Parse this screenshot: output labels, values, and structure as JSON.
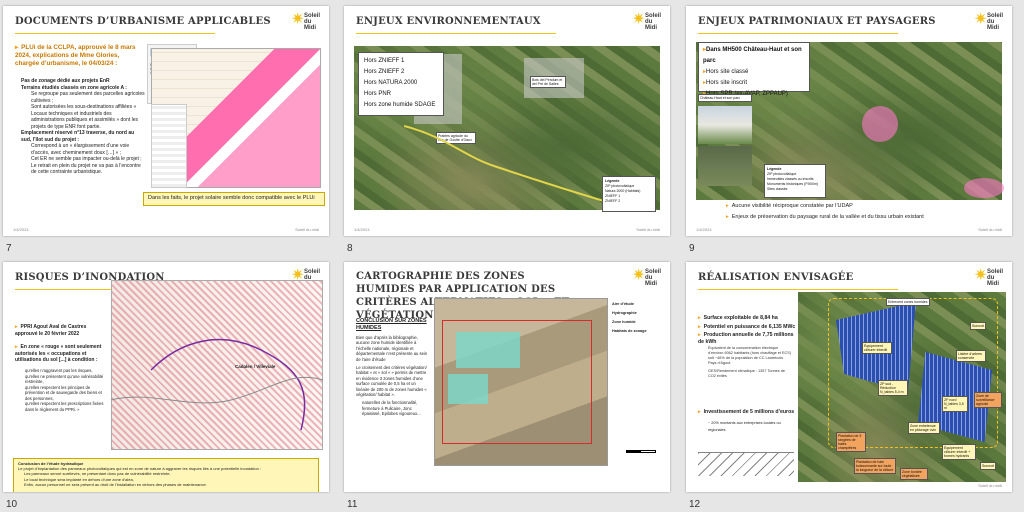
{
  "slides": [
    {
      "number": "7",
      "title": "DOCUMENTS D’URBANISME APPLICABLES",
      "intro": "PLUi de la CCLPA, approuvé le 8 mars 2024, explications de Mme Glories, chargée d’urbanisme, le 04/03/24 :",
      "bullets": [
        "Pas de zonage dédié aux projets EnR",
        "Terrains étudiés classés en zone agricole A :",
        "Se regroupe pas seulement des parcelles agricoles cultivées ;",
        "Sont autorisées les sous-destinations affiliées « Locaux techniques et industriels des administrations publiques et assimilés » dont les projets de type ENR font partie.",
        "Emplacement réservé n°13 traverse, du nord au sud, l’îlot sud du projet :",
        "Correspond à un « élargissement d’une voie d’accès, avec cheminement doux […] » ;",
        "Cet ER ne semble pas impacter ou-delà le projet ;",
        "Le retrait en plein du projet ne va pas à l’encontre de cette contrainte urbanistique."
      ],
      "plui_doc": "ÉLABORATION DU PLAN LOCAL D’URBANISME INTERCOMMUNAL",
      "conclusion": "Dans les faits, le projet solaire semble donc compatible avec le PLUi"
    },
    {
      "number": "8",
      "title": "ENJEUX ENVIRONNEMENTAUX",
      "items": [
        "Hors ZNIEFF 1",
        "Hors ZNIEFF 2",
        "Hors NATURA 2000",
        "Hors PNR",
        "Hors zone humide SDAGE"
      ],
      "labels": [
        "Bois del Pendum et del Pré de Salles",
        "Prairies agricole du bas de Goutte d'Oaux"
      ],
      "legend_title": "Légende",
      "legend": [
        "ZIP photovoltaïque",
        "Natura 2000 (Habitats)",
        "ZNIEFF 1",
        "ZNIEFF 2"
      ]
    },
    {
      "number": "9",
      "title": "ENJEUX PATRIMONIAUX ET PAYSAGERS",
      "items": [
        "Dans MH500 Château-Haut et son parc",
        "Hors site classé",
        "Hors site inscrit",
        "Hors SPR (ex-AVAP, ZPPAUP)"
      ],
      "caption": "Château-Haut et son parc",
      "legend_title": "Légende",
      "legend": [
        "ZIP photovoltaïque",
        "Immeubles classés ou inscrits",
        "Monuments historiques (P.500m)",
        "Sites classés"
      ],
      "notes": [
        "Aucune visibilité réciproque constatée par l’UDAP",
        "Enjeux de préservation du paysage rural de la vallée et du tissu urbain existant"
      ]
    },
    {
      "number": "10",
      "title": "RISQUES D’INONDATION",
      "intro": "PPRI Agout Aval de Castres approuvé le 20 février 2022",
      "zone": "En zone « rouge » sont seulement autorisés les « occupations et utilisations du sol [...] à condition :",
      "subs": [
        "qu’elles n’aggravent pas les risques,",
        "qu’elles ne présentent qu’une vulnérabilité restreinte,",
        "qu’elles respectent les principes de prévention et de sauvegarde des biens et des personnes,",
        "qu’elles respectent les prescriptions fixées dans le règlement du PPRi. »"
      ],
      "map_label": "Cadalen / Villeviale",
      "conclusion_title": "Conclusion de l’étude hydraulique",
      "conclusion": [
        "Le projet d’implantation des panneaux photovoltaïques qui est en zone de nature à aggraver les risques liés à une potentielle inondation :",
        "Les panneaux seront surélevés, ne présentant donc pas de vulnérabilité restreinte,",
        "Le local technique sera implanté en dehors d’une zone d’aléa,",
        "Enfin, aucun personnel ne sera présent au droit de l’installation en dehors des phases de maintenance."
      ]
    },
    {
      "number": "11",
      "title": "CARTOGRAPHIE DES ZONES HUMIDES PAR APPLICATION DES CRITÈRES ALTERNATIFS « SOL » ET « VÉGÉTATION »",
      "conclusion_head": "CONCLUSION SUR ZONES HUMIDES",
      "text": [
        "Bien que d’après la bibliographie, aucune zone humide identifiée à l’échelle nationale, régionale et départementale n’est présente au sein de l’aire d’étude",
        "Le croisement des critères végétation/ habitat « et » sol « » permis de mettre en évidence 3 zones humides d’une surface cumulée de 0,5 ha et un linéaire de 200 m de zones humides « végétation/ habitat »."
      ],
      "subs": [
        "naturelles de la fonctionnalité,",
        "fermeture à Pulicaire, Jonc épaisissé, Epilobes vigoureux..."
      ],
      "legend": [
        "Aire d’étude",
        "Hydrographie",
        "Zone humide",
        "Habitats de zonage"
      ]
    },
    {
      "number": "12",
      "title": "RÉALISATION ENVISAGÉE",
      "items": [
        "Surface exploitable de 8,84 ha",
        "Potentiel en puissance de 6,135 MWc",
        "Production annuelle de 7,75 millions de kWh",
        "Investissement de 5 millions d’euros"
      ],
      "subs": [
        "Équivalent de la consommation électrique d’environ 6062 habitants (hors chauffage et ECS) soit ~46% de la population de CC Lautrécois Pays d’Agout",
        "GES/Rendement climatique : 1357 Tonnes de CO2 évités",
        "~ 20% montants aux entreprises locales ou régionales"
      ],
      "labels": [
        "Entrecent zones humides",
        "Surcroit",
        "Équipement clôturer interdit",
        "ZP sud - Réduction N_tables 5,4 m",
        "ZP nord N_tables 3,5 m",
        "Lisière d’arbres conservée",
        "Zone de surveillance agricole",
        "Zone entretenue en pâturage ovin",
        "Plantation de 3 rangées de haies champêtres",
        "Équipement clôturer interdit + bornes hydrants",
        "Surcroit",
        "Plantation de haie buissonnante sur toute la longueur de la clôture",
        "Zone bordée végétalisée"
      ]
    }
  ]
}
